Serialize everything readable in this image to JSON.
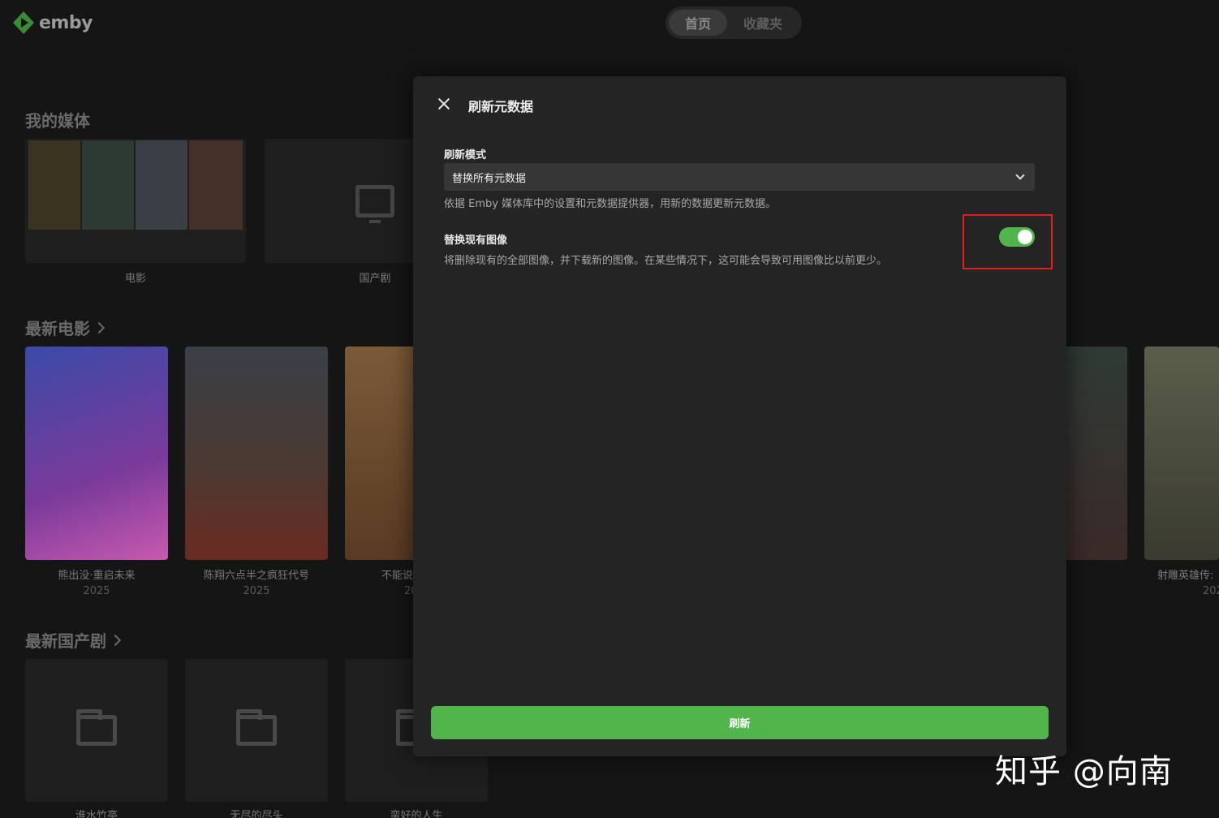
{
  "app": {
    "logo_text": "emby",
    "brand_color": "#52b54b"
  },
  "nav": {
    "tabs": [
      {
        "label": "首页",
        "active": true
      },
      {
        "label": "收藏夹",
        "active": false
      }
    ]
  },
  "sections": {
    "my_media": {
      "title": "我的媒体",
      "items": [
        {
          "label": "电影",
          "icon": "poster-collage"
        },
        {
          "label": "国产剧",
          "icon": "tv-icon"
        }
      ]
    },
    "latest_movies": {
      "title": "最新电影",
      "items": [
        {
          "title": "熊出没·重启未来",
          "year": "2025"
        },
        {
          "title": "陈翔六点半之疯狂代号",
          "year": "2025"
        },
        {
          "title": "不能说",
          "year": "20"
        },
        {
          "title": "",
          "year": ""
        },
        {
          "title": "射雕英雄传:",
          "year": "202"
        }
      ]
    },
    "latest_tv": {
      "title": "最新国产剧",
      "items": [
        {
          "title": "淮水竹亭",
          "icon": "folder-icon"
        },
        {
          "title": "无尽的尽头",
          "icon": "folder-icon"
        },
        {
          "title": "蛮好的人生",
          "icon": "folder-icon"
        }
      ]
    }
  },
  "modal": {
    "title": "刷新元数据",
    "refresh_mode_label": "刷新模式",
    "refresh_mode_value": "替换所有元数据",
    "refresh_mode_help": "依据 Emby 媒体库中的设置和元数据提供器，用新的数据更新元数据。",
    "replace_images_label": "替换现有图像",
    "replace_images_help": "将删除现有的全部图像，并下载新的图像。在某些情况下，这可能会导致可用图像比以前更少。",
    "replace_images_enabled": true,
    "refresh_button": "刷新"
  },
  "watermark": "知乎 @向南"
}
